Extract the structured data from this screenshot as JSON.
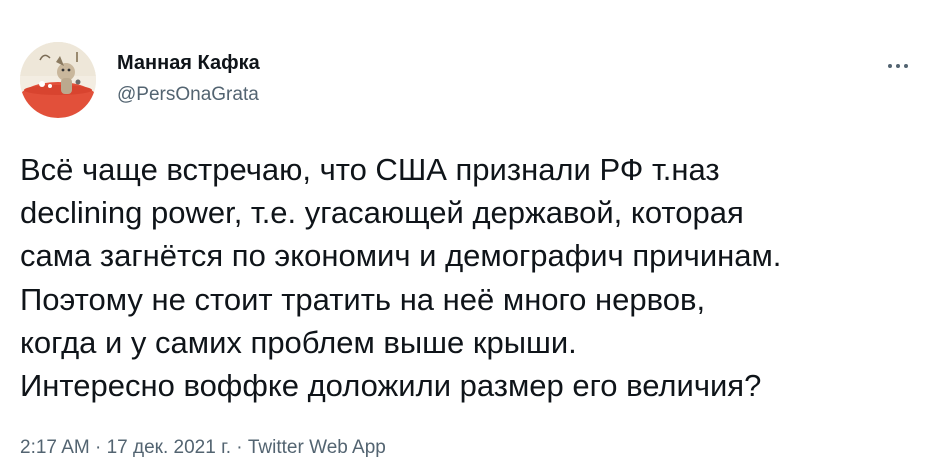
{
  "author": {
    "name": "Манная Кафка",
    "handle": "@PersOnaGrata",
    "avatar_icon": "avatar-cartoon-icon"
  },
  "more_icon": "more-options-icon",
  "tweet": {
    "lines": [
      "Всё чаще встречаю, что США признали РФ т.наз",
      "declining power, т.е. угасающей державой, которая",
      "сама загнётся по экономич и демографич причинам.",
      "Поэтому не стоит тратить на неё много нервов,",
      "когда и у самих проблем выше крыши.",
      "Интересно воффке доложили размер его величия?"
    ]
  },
  "meta": {
    "time": "2:17 AM",
    "separator": "·",
    "date": "17 дек. 2021 г.",
    "source": "Twitter Web App"
  },
  "colors": {
    "text": "#0f1419",
    "secondary": "#536471",
    "avatar_accent": "#e2503a"
  }
}
